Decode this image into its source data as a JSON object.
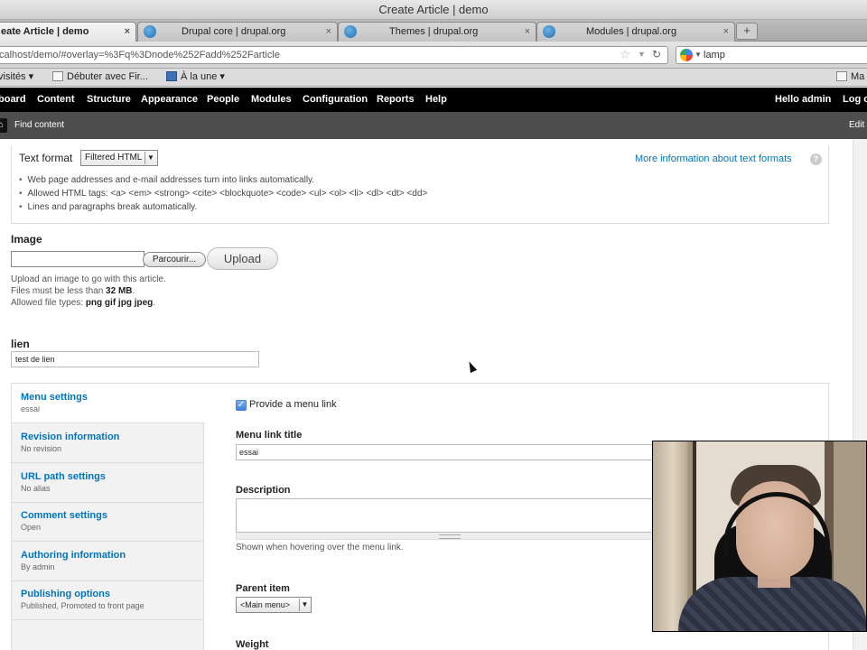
{
  "browser": {
    "window_title": "Create Article | demo",
    "tabs": [
      {
        "label": "eate Article | demo",
        "active": true
      },
      {
        "label": "Drupal core | drupal.org",
        "active": false
      },
      {
        "label": "Themes | drupal.org",
        "active": false
      },
      {
        "label": "Modules | drupal.org",
        "active": false
      }
    ],
    "tab_close": "×",
    "new_tab": "+",
    "url": "calhost/demo/#overlay=%3Fq%3Dnode%252Fadd%252Farticle",
    "search_value": "lamp",
    "bookmarks": [
      "visités ▾",
      "Débuter avec Fir...",
      "À la une ▾",
      "Ma"
    ]
  },
  "toolbar": {
    "items": [
      "board",
      "Content",
      "Structure",
      "Appearance",
      "People",
      "Modules",
      "Configuration",
      "Reports",
      "Help"
    ],
    "greeting": "Hello admin",
    "logout": "Log o"
  },
  "shortcuts": {
    "home": "⌂",
    "find_content": "Find content",
    "edit": "Edit"
  },
  "text_format": {
    "label": "Text format",
    "selected": "Filtered HTML",
    "more_info": "More information about text formats",
    "help_icon": "?",
    "tips": [
      "Web page addresses and e-mail addresses turn into links automatically.",
      "Allowed HTML tags: <a> <em> <strong> <cite> <blockquote> <code> <ul> <ol> <li> <dl> <dt> <dd>",
      "Lines and paragraphs break automatically."
    ]
  },
  "image_field": {
    "label": "Image",
    "browse": "Parcourir...",
    "upload": "Upload",
    "help1": "Upload an image to go with this article.",
    "help2_prefix": "Files must be less than ",
    "help2_value": "32 MB",
    "help2_suffix": ".",
    "help3_prefix": "Allowed file types: ",
    "help3_value": "png gif jpg jpeg",
    "help3_suffix": "."
  },
  "lien_field": {
    "label": "lien",
    "value": "test de lien"
  },
  "vertical_tabs": [
    {
      "title": "Menu settings",
      "summary": "essai",
      "selected": true
    },
    {
      "title": "Revision information",
      "summary": "No revision",
      "selected": false
    },
    {
      "title": "URL path settings",
      "summary": "No alias",
      "selected": false
    },
    {
      "title": "Comment settings",
      "summary": "Open",
      "selected": false
    },
    {
      "title": "Authoring information",
      "summary": "By admin",
      "selected": false
    },
    {
      "title": "Publishing options",
      "summary": "Published, Promoted to front page",
      "selected": false
    }
  ],
  "menu_pane": {
    "provide_link_label": "Provide a menu link",
    "provide_link_checked": true,
    "link_title_label": "Menu link title",
    "link_title_value": "essai",
    "description_label": "Description",
    "description_help": "Shown when hovering over the menu link.",
    "parent_label": "Parent item",
    "parent_selected": "<Main menu>",
    "weight_label": "Weight"
  },
  "colors": {
    "link": "#0074bd",
    "toolbar_bg": "#000000",
    "shortcut_bg": "#4d4d4d"
  }
}
